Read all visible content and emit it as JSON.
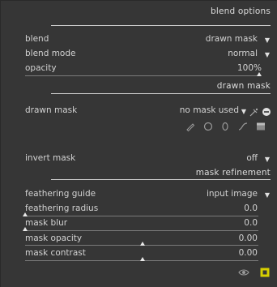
{
  "sections": {
    "blend_options": "blend options",
    "drawn_mask": "drawn mask",
    "mask_refinement": "mask refinement"
  },
  "rows": {
    "blend": {
      "label": "blend",
      "value": "drawn mask"
    },
    "blend_mode": {
      "label": "blend mode",
      "value": "normal"
    },
    "opacity": {
      "label": "opacity",
      "value": "100%",
      "level": 1.0
    },
    "drawn_mask": {
      "label": "drawn mask",
      "value": "no mask used"
    },
    "invert_mask": {
      "label": "invert mask",
      "value": "off"
    },
    "feathering_guide": {
      "label": "feathering guide",
      "value": "input image"
    },
    "feathering_radius": {
      "label": "feathering radius",
      "value": "0.0",
      "level": 0.0
    },
    "mask_blur": {
      "label": "mask blur",
      "value": "0.0",
      "level": 0.0
    },
    "mask_opacity": {
      "label": "mask opacity",
      "value": "0.00",
      "level": 0.5
    },
    "mask_contrast": {
      "label": "mask contrast",
      "value": "0.00",
      "level": 0.5
    }
  },
  "icons": {
    "dropdown_arrow": "▼",
    "shape_tools": [
      "pencil-icon",
      "circle-icon",
      "ellipse-icon",
      "path-icon",
      "gradient-icon"
    ],
    "bottom": [
      "eye-icon",
      "display-mask-icon"
    ]
  },
  "colors": {
    "background": "#363636",
    "text": "#d2d2d2",
    "accent_mask_button": "#d8d000"
  }
}
